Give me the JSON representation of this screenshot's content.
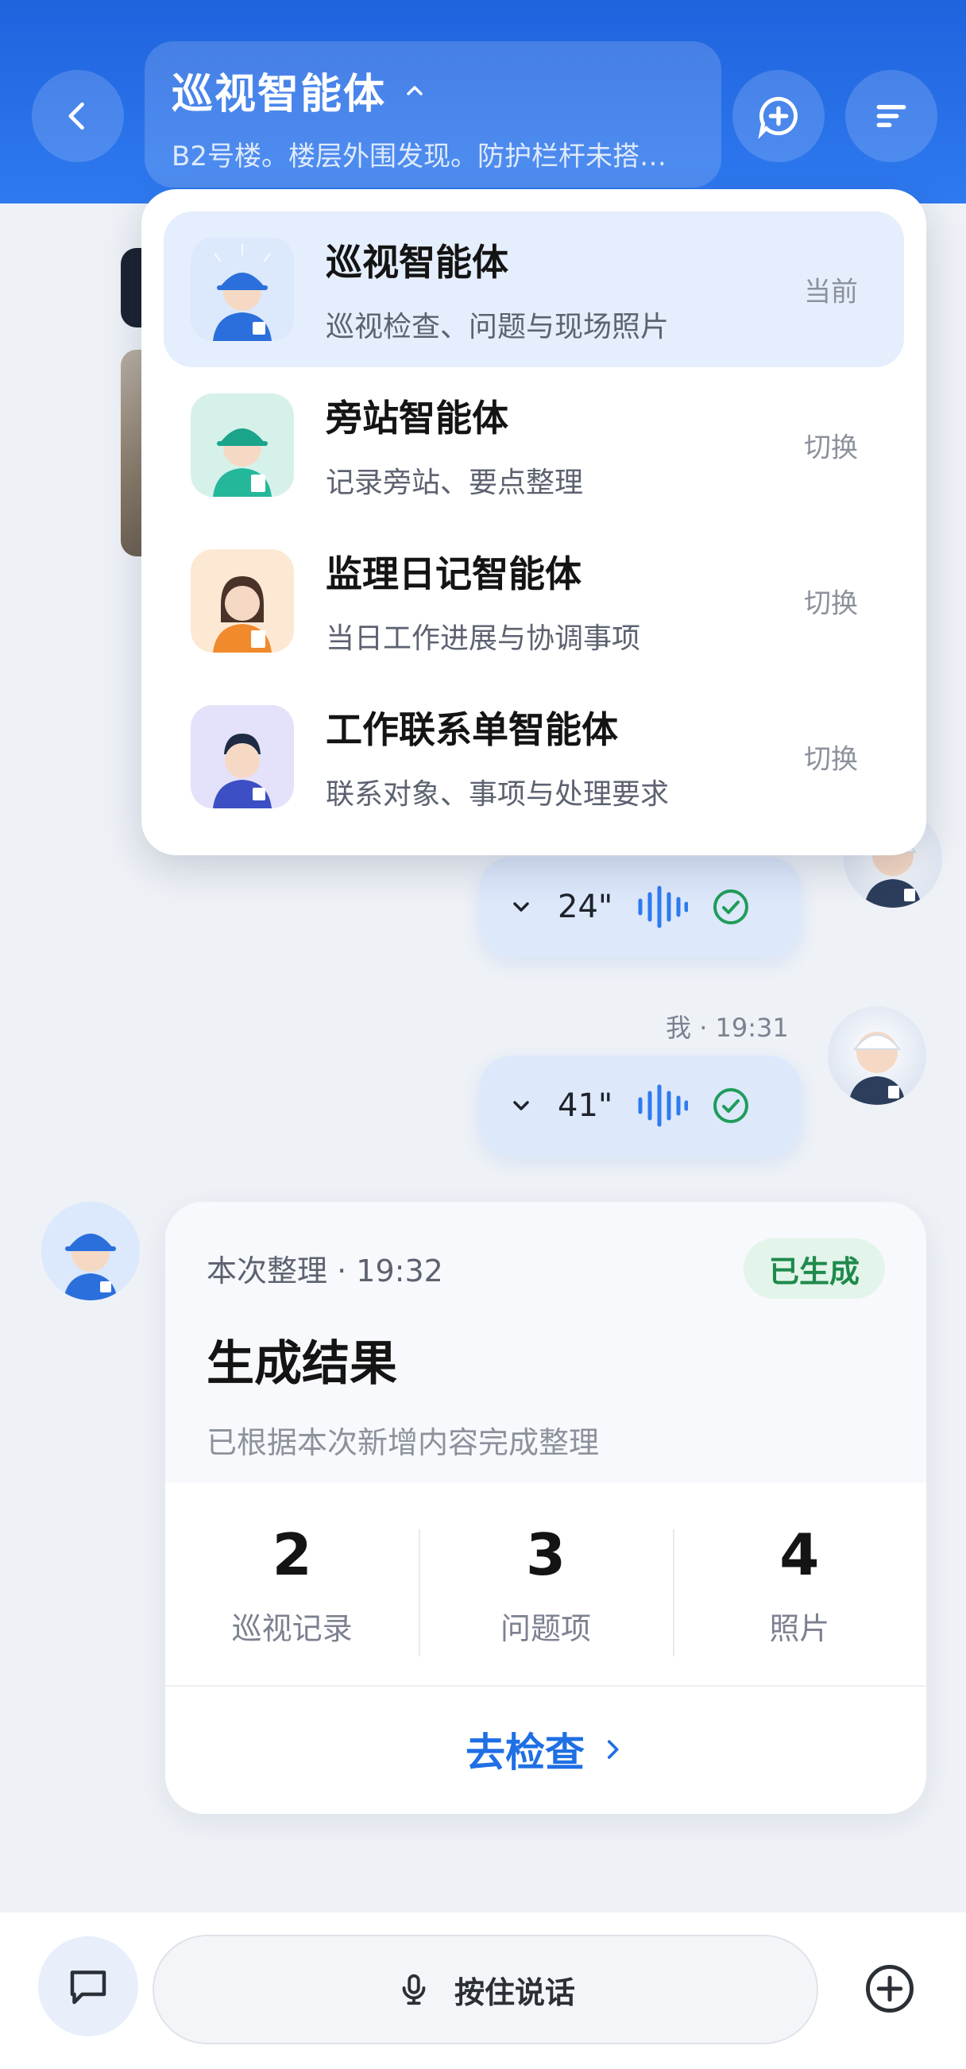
{
  "header": {
    "title": "巡视智能体",
    "subtitle": "B2号楼。楼层外围发现。防护栏杆未搭…"
  },
  "chat": {
    "voice_messages": [
      {
        "duration": "24\""
      },
      {
        "duration": "41\"",
        "sender": "我",
        "time": "19:31"
      }
    ]
  },
  "result": {
    "label": "本次整理",
    "time": "19:32",
    "badge": "已生成",
    "title": "生成结果",
    "description": "已根据本次新增内容完成整理",
    "stats": [
      {
        "value": "2",
        "label": "巡视记录"
      },
      {
        "value": "3",
        "label": "问题项"
      },
      {
        "value": "4",
        "label": "照片"
      }
    ],
    "action": "去检查"
  },
  "bottom": {
    "talk_label": "按住说话"
  },
  "dropdown": {
    "agents": [
      {
        "name": "巡视智能体",
        "desc": "巡视检查、问题与现场照片",
        "action": "当前"
      },
      {
        "name": "旁站智能体",
        "desc": "记录旁站、要点整理",
        "action": "切换"
      },
      {
        "name": "监理日记智能体",
        "desc": "当日工作进展与协调事项",
        "action": "切换"
      },
      {
        "name": "工作联系单智能体",
        "desc": "联系对象、事项与处理要求",
        "action": "切换"
      }
    ]
  },
  "colors": {
    "header": "#2f7af0",
    "accent": "#1f6fe5",
    "success": "#1f8a4c",
    "voice_bubble": "#dde8fb"
  }
}
